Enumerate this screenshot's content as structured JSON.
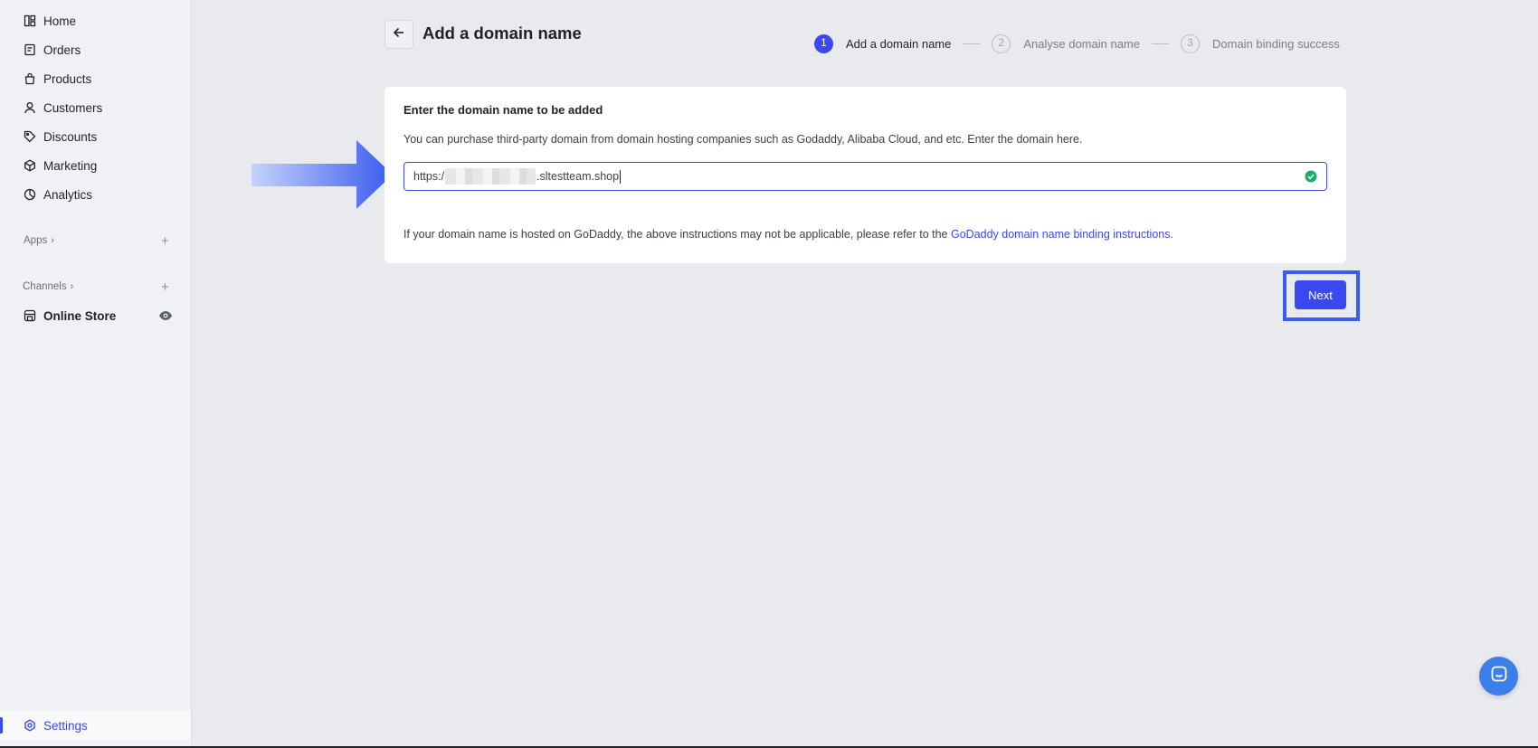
{
  "sidebar": {
    "items": [
      {
        "label": "Home",
        "icon": "home-icon"
      },
      {
        "label": "Orders",
        "icon": "orders-icon"
      },
      {
        "label": "Products",
        "icon": "products-icon"
      },
      {
        "label": "Customers",
        "icon": "customers-icon"
      },
      {
        "label": "Discounts",
        "icon": "discounts-icon"
      },
      {
        "label": "Marketing",
        "icon": "marketing-icon"
      },
      {
        "label": "Analytics",
        "icon": "analytics-icon"
      }
    ],
    "apps_label": "Apps",
    "channels_label": "Channels",
    "online_store_label": "Online Store",
    "settings_label": "Settings"
  },
  "header": {
    "title": "Add a domain name"
  },
  "steps": [
    {
      "number": "1",
      "label": "Add a domain name",
      "state": "active"
    },
    {
      "number": "2",
      "label": "Analyse domain name",
      "state": "inactive"
    },
    {
      "number": "3",
      "label": "Domain binding success",
      "state": "inactive"
    }
  ],
  "card": {
    "title": "Enter the domain name to be added",
    "description": "You can purchase third-party domain from domain hosting companies such as Godaddy, Alibaba Cloud, and etc. Enter the domain here.",
    "input_prefix": "https:/",
    "input_suffix": ".sltestteam.shop",
    "note_text": "If your domain name is hosted on GoDaddy, the above instructions may not be applicable, please refer to the ",
    "note_link": "GoDaddy domain name binding instructions."
  },
  "actions": {
    "next_label": "Next"
  },
  "colors": {
    "accent": "#3a48f0",
    "success": "#1aad6e",
    "chat": "#3d7fe8"
  }
}
